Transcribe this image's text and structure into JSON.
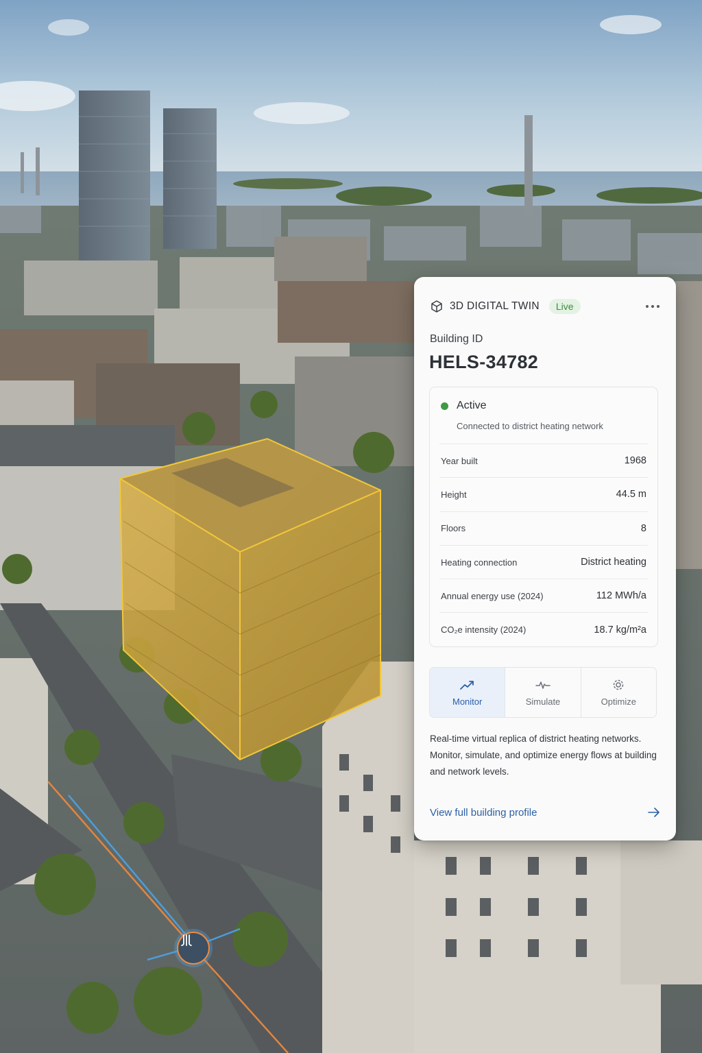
{
  "card": {
    "header": {
      "title": "3D DIGITAL TWIN",
      "badge": "Live"
    },
    "building_id_label": "Building ID",
    "building_id": "HELS-34782",
    "status": {
      "label": "Active",
      "description": "Connected to district heating network"
    },
    "info_rows": [
      {
        "label": "Year built",
        "value": "1968"
      },
      {
        "label": "Height",
        "value": "44.5 m"
      },
      {
        "label": "Floors",
        "value": "8"
      },
      {
        "label": "Heating connection",
        "value": "District heating"
      },
      {
        "label": "Annual energy use (2024)",
        "value": "112 MWh/a"
      },
      {
        "label": "CO₂e intensity (2024)",
        "value": "18.7 kg/m²a"
      }
    ],
    "tabs": [
      {
        "label": "Monitor",
        "icon": "trend-up-icon",
        "active": true
      },
      {
        "label": "Simulate",
        "icon": "pulse-icon",
        "active": false
      },
      {
        "label": "Optimize",
        "icon": "gear-icon",
        "active": false
      }
    ],
    "description": "Real-time virtual replica of district heating networks. Monitor, simulate, and optimize energy flows at building and network levels.",
    "link_label": "View full building profile"
  },
  "colors": {
    "highlight": "#e8b92a",
    "accent": "#2b5fa6",
    "status_active": "#3f9a45",
    "network_line_orange": "#f08a3c",
    "network_line_blue": "#4aa3e8"
  },
  "scene": {
    "icons": [
      "heating-node-icon"
    ]
  }
}
